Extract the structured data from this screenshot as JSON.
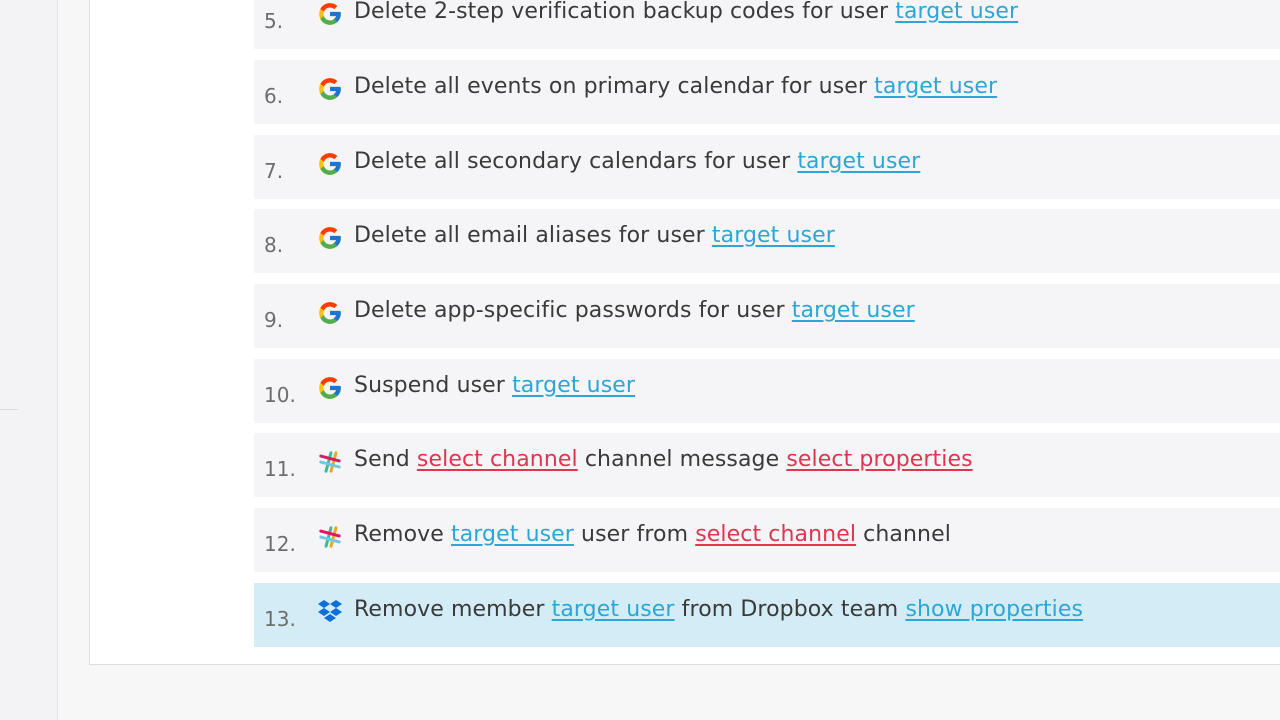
{
  "steps": [
    {
      "num": "5.",
      "app": "google",
      "parts": [
        "Delete 2-step verification backup codes for user ",
        "target user"
      ],
      "kinds": [
        "text",
        "blue"
      ]
    },
    {
      "num": "6.",
      "app": "google",
      "parts": [
        "Delete all events on primary calendar for user ",
        "target user"
      ],
      "kinds": [
        "text",
        "blue"
      ]
    },
    {
      "num": "7.",
      "app": "google",
      "parts": [
        "Delete all secondary calendars for user ",
        "target user"
      ],
      "kinds": [
        "text",
        "blue"
      ]
    },
    {
      "num": "8.",
      "app": "google",
      "parts": [
        "Delete all email aliases for user ",
        "target user"
      ],
      "kinds": [
        "text",
        "blue"
      ]
    },
    {
      "num": "9.",
      "app": "google",
      "parts": [
        "Delete app-specific passwords for user ",
        "target user"
      ],
      "kinds": [
        "text",
        "blue"
      ]
    },
    {
      "num": "10.",
      "app": "google",
      "parts": [
        "Suspend user ",
        "target user"
      ],
      "kinds": [
        "text",
        "blue"
      ]
    },
    {
      "num": "11.",
      "app": "slack",
      "parts": [
        "Send ",
        "select channel",
        " channel message ",
        "select properties"
      ],
      "kinds": [
        "text",
        "red",
        "text",
        "red"
      ]
    },
    {
      "num": "12.",
      "app": "slack",
      "parts": [
        "Remove ",
        "target user",
        " user from ",
        "select channel",
        " channel"
      ],
      "kinds": [
        "text",
        "blue",
        "text",
        "red",
        "text"
      ]
    },
    {
      "num": "13.",
      "app": "dropbox",
      "parts": [
        "Remove member ",
        "target user",
        " from Dropbox team ",
        "show properties"
      ],
      "kinds": [
        "text",
        "blue",
        "text",
        "blue"
      ],
      "active": true
    }
  ],
  "icons": {
    "google": "google-icon",
    "slack": "slack-icon",
    "dropbox": "dropbox-icon"
  },
  "colors": {
    "link_blue": "#2aa7d8",
    "link_red": "#e2334f",
    "active_row": "#d3ecf5",
    "row": "#f5f5f7"
  }
}
